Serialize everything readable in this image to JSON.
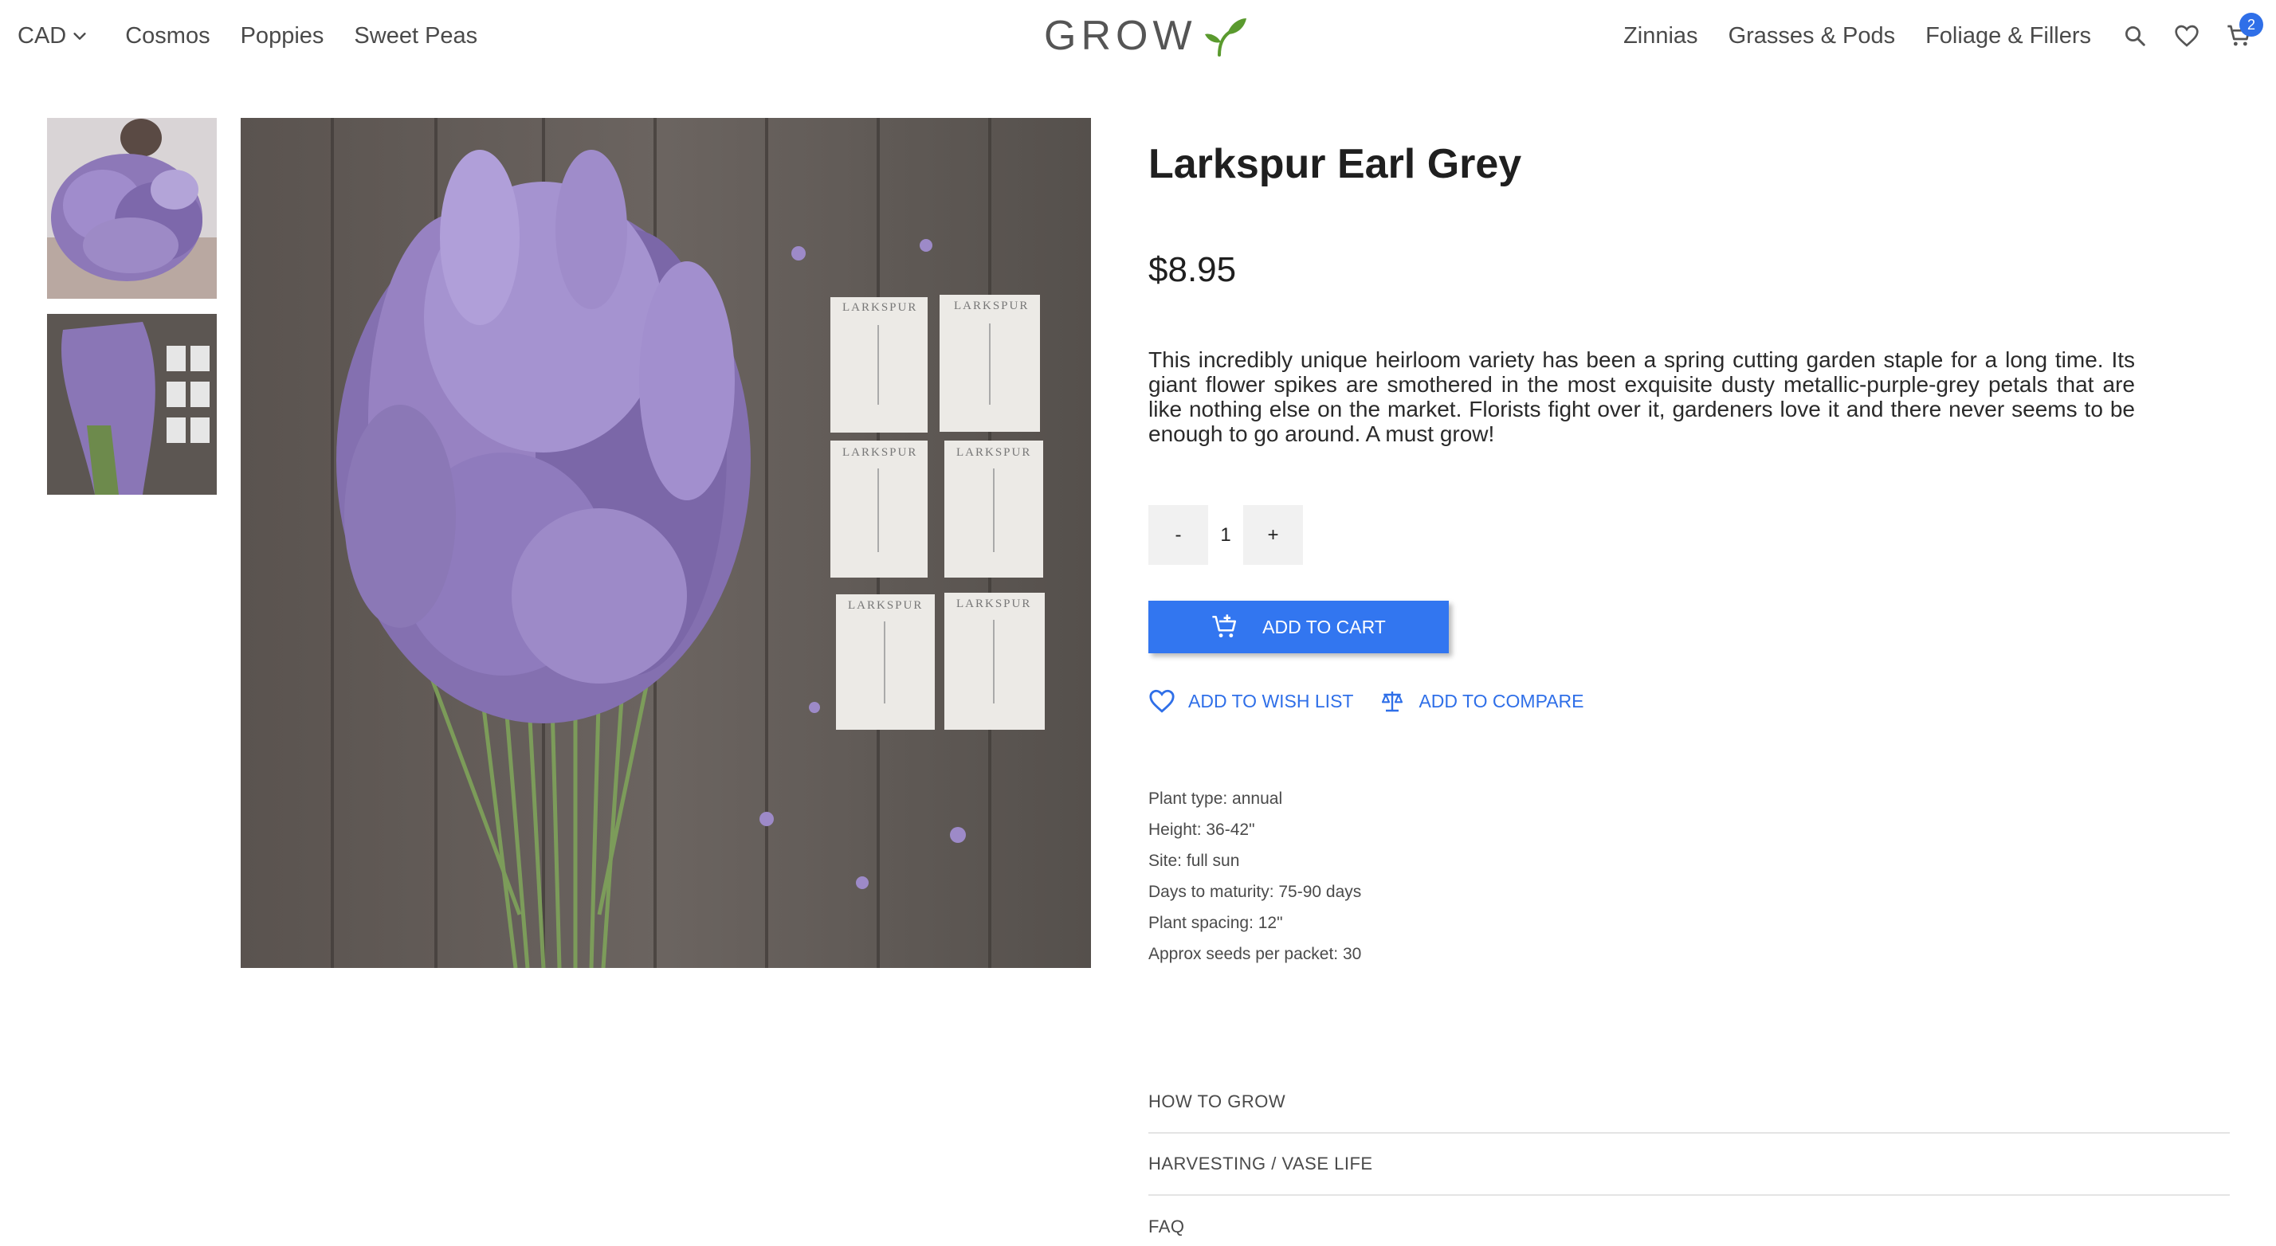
{
  "header": {
    "currency": "CAD",
    "nav_left": [
      "Cosmos",
      "Poppies",
      "Sweet Peas"
    ],
    "logo_text": "GROW",
    "nav_right": [
      "Zinnias",
      "Grasses & Pods",
      "Foliage & Fillers"
    ],
    "cart_count": "2"
  },
  "gallery": {
    "thumbnails": [
      "bouquet-with-person",
      "flowers-with-seed-packets"
    ],
    "main_image": "larkspur-bouquet-with-seed-packets",
    "packet_label": "LARKSPUR"
  },
  "product": {
    "title": "Larkspur Earl Grey",
    "price": "$8.95",
    "description": "This incredibly unique heirloom variety has been a spring cutting garden staple for a long time. Its giant flower spikes are smothered in the most exquisite dusty metallic-purple-grey petals that are like nothing else on the market. Florists fight over it, gardeners love it and there never seems to be enough to go around. A must grow!",
    "quantity": {
      "decrement": "-",
      "value": "1",
      "increment": "+"
    },
    "add_to_cart": "ADD TO CART",
    "add_to_wishlist": "ADD TO WISH LIST",
    "add_to_compare": "ADD TO COMPARE",
    "specs": [
      "Plant type: annual",
      "Height: 36-42\"",
      "Site: full sun",
      "Days to maturity: 75-90 days",
      "Plant spacing: 12\"",
      "Approx seeds per packet: 30"
    ],
    "accordion": [
      "HOW TO GROW",
      "HARVESTING / VASE LIFE",
      "FAQ"
    ]
  },
  "colors": {
    "accent": "#3276f0",
    "link": "#2f6fe8",
    "logo_leaf": "#5a9a2e"
  }
}
